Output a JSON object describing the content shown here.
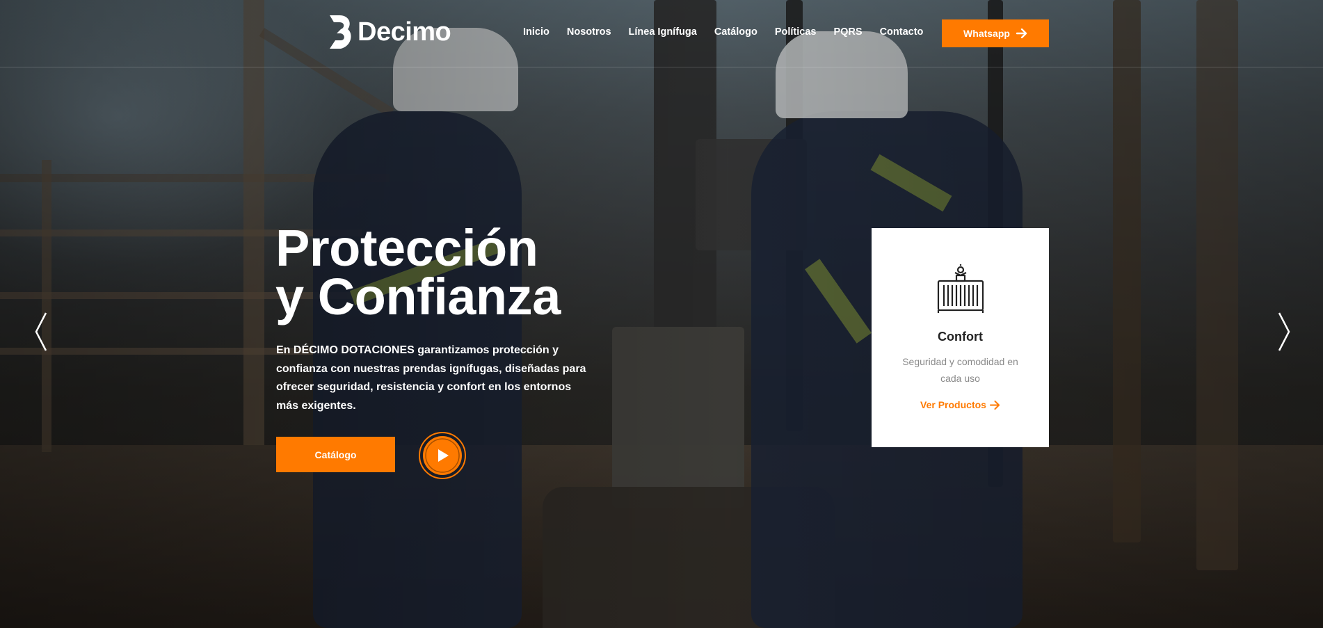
{
  "brand": {
    "name": "Decimo"
  },
  "nav": {
    "items": [
      {
        "label": "Inicio"
      },
      {
        "label": "Nosotros"
      },
      {
        "label": "Línea Ignífuga"
      },
      {
        "label": "Catálogo"
      },
      {
        "label": "Políticas"
      },
      {
        "label": "PQRS"
      },
      {
        "label": "Contacto"
      }
    ],
    "cta_label": "Whatsapp"
  },
  "hero": {
    "title_line1": "Protección",
    "title_line2": "y Confianza",
    "description": "En DÉCIMO DOTACIONES garantizamos protección y confianza con nuestras prendas ignífugas, diseñadas para ofrecer seguridad, resistencia y confort en los entornos más exigentes.",
    "button_label": "Catálogo"
  },
  "feature_card": {
    "icon": "container-icon",
    "title": "Confort",
    "subtitle": "Seguridad y comodidad en cada uso",
    "link_label": "Ver Productos"
  },
  "colors": {
    "accent": "#ff7a00",
    "text_light": "#ffffff",
    "card_bg": "#ffffff",
    "card_title": "#222222",
    "card_sub": "#8a8a8a"
  }
}
